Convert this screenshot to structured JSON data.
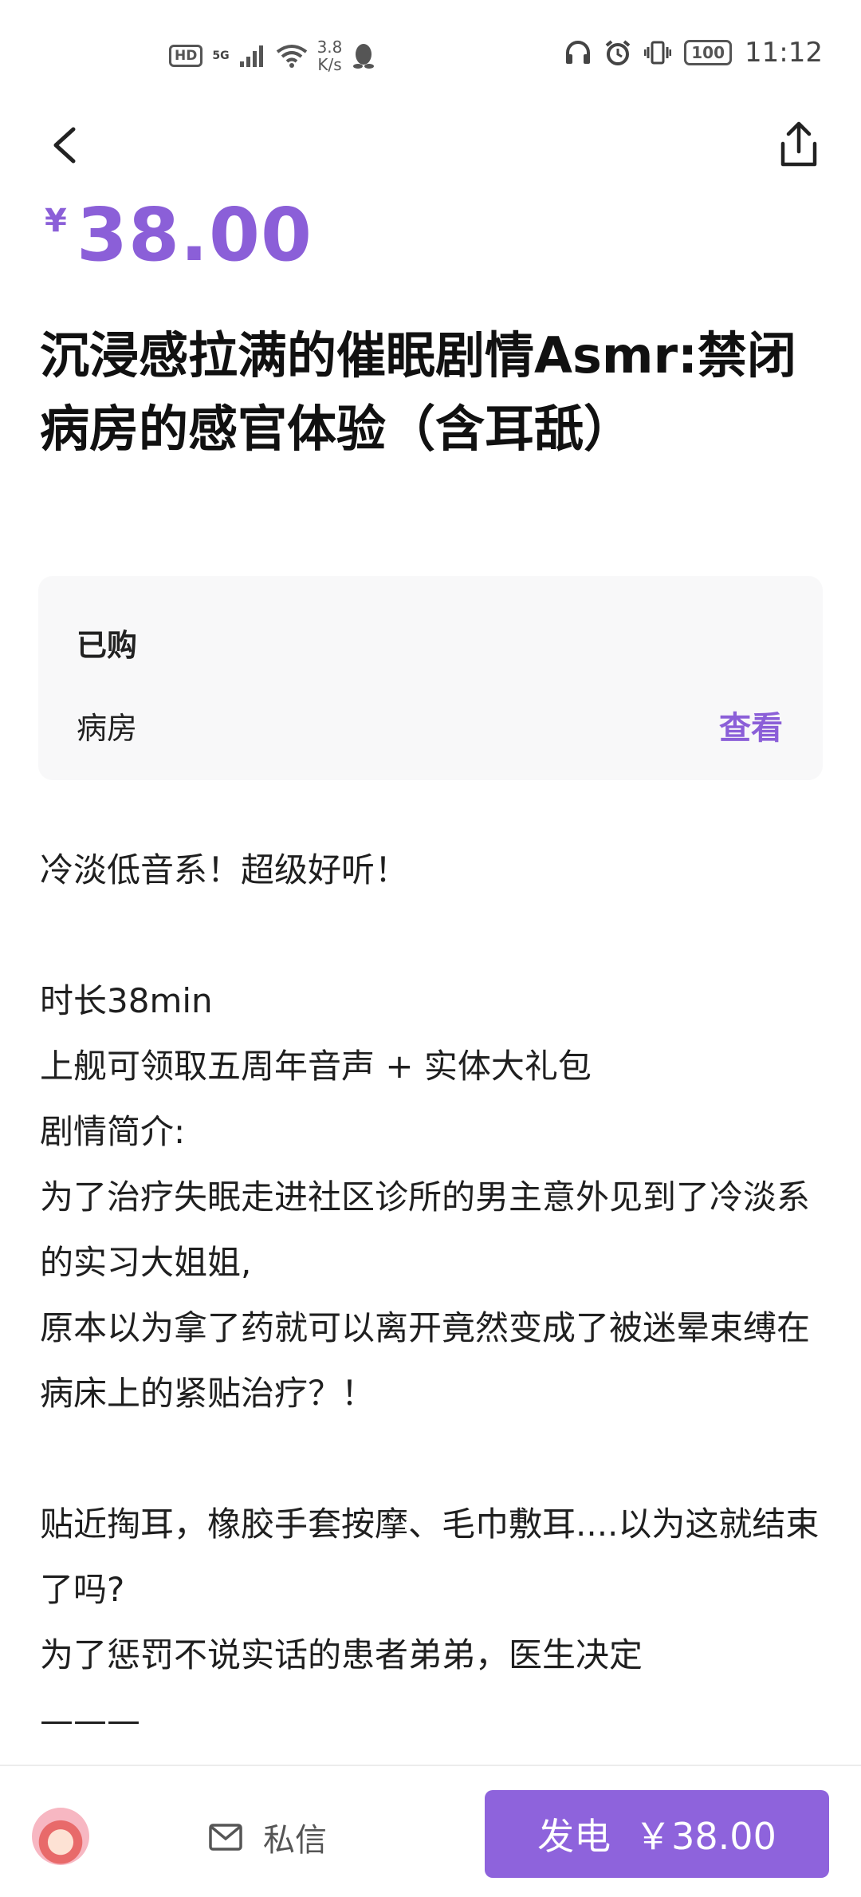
{
  "status_bar": {
    "hd": "HD",
    "network": "5G",
    "speed_value": "3.8",
    "speed_unit": "K/s",
    "battery": "100",
    "time": "11:12"
  },
  "nav": {
    "back_icon": "chevron-left-icon",
    "share_icon": "share-icon"
  },
  "product": {
    "currency_symbol": "¥",
    "price": "38.00",
    "title": "沉浸感拉满的催眠剧情Asmr:禁闭病房的感官体验（含耳舐）"
  },
  "purchased": {
    "heading": "已购",
    "item": "病房",
    "view_label": "查看"
  },
  "description": {
    "lines": [
      "冷淡低音系！超级好听！",
      "",
      "时长38min",
      "上舰可领取五周年音声 + 实体大礼包",
      "剧情简介:",
      "为了治疗失眠走进社区诊所的男主意外见到了冷淡系的实习大姐姐,",
      "原本以为拿了药就可以离开竟然变成了被迷晕束缚在病床上的紧贴治疗？！",
      "",
      "贴近掏耳，橡胶手套按摩、毛巾敷耳....以为这就结束了吗?",
      "为了惩罚不说实话的患者弟弟，医生决定",
      "———"
    ]
  },
  "bottom_bar": {
    "message_label": "私信",
    "charge_label": "发电",
    "charge_price": "￥38.00"
  },
  "colors": {
    "accent": "#8b5fd8",
    "button": "#8e63dc",
    "card_bg": "#f8f8f9"
  }
}
